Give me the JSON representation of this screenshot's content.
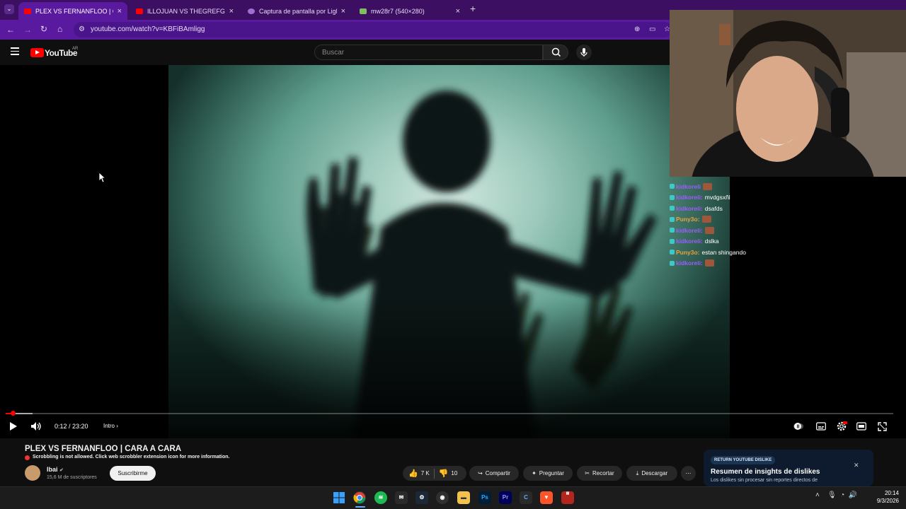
{
  "browser": {
    "tabs": [
      {
        "title": "PLEX VS FERNANFLOO | CARA A",
        "active": true,
        "favicon": "youtube-icon",
        "color": "#ff0000"
      },
      {
        "title": "ILLOJUAN VS THEGREFG | CARA",
        "active": false,
        "favicon": "youtube-icon",
        "color": "#ff0000"
      },
      {
        "title": "Captura de pantalla por Lightsh",
        "active": false,
        "favicon": "lightshot-icon",
        "color": "#a070d0"
      },
      {
        "title": "mw28r7 (540×280)",
        "active": false,
        "favicon": "image-icon",
        "color": "#7fbf5f"
      }
    ],
    "url": "youtube.com/watch?v=KBFiBAmligg",
    "theme_color": "#5a1aa0"
  },
  "youtube": {
    "logo_text": "YouTube",
    "region": "AR",
    "search_placeholder": "Buscar",
    "player": {
      "time": "0:12 / 23:20",
      "chapter": "Intro",
      "progress_fraction": 0.0086,
      "buffered_fraction": 0.03
    },
    "video": {
      "title": "PLEX VS FERNANFLOO | CARA A CARA",
      "scrobble_notice": "Scrobbling is not allowed. Click web scrobbler extension icon for more information.",
      "channel": "Ibai",
      "subscribers": "15,6 M de suscriptores",
      "subscribe_label": "Suscribirme",
      "likes": "7 K",
      "dislikes": "10",
      "share_label": "Compartir",
      "ask_label": "Preguntar",
      "clip_label": "Recortar",
      "download_label": "Descargar"
    },
    "extension": {
      "badge": "RETURN YOUTUBE DISLIKE",
      "title": "Resumen de insights de dislikes",
      "subtitle": "Los dislikes sin procesar sin reportes directos de"
    }
  },
  "chat": [
    {
      "user": "kidkoreli",
      "message": "",
      "emote": true,
      "user_color": "#9b5cff"
    },
    {
      "user": "kidkoreli:",
      "message": "mvdgsxñl",
      "emote": false,
      "user_color": "#9b5cff"
    },
    {
      "user": "kidkoreli:",
      "message": "dsafds",
      "emote": false,
      "user_color": "#9b5cff"
    },
    {
      "user": "Puny3o:",
      "message": "",
      "emote": true,
      "user_color": "#e8a33c"
    },
    {
      "user": "kidkoreli:",
      "message": "",
      "emote": true,
      "user_color": "#9b5cff"
    },
    {
      "user": "kidkoreli:",
      "message": "dslka",
      "emote": false,
      "user_color": "#9b5cff"
    },
    {
      "user": "Puny3o:",
      "message": "estan shingando",
      "emote": false,
      "user_color": "#e8a33c"
    },
    {
      "user": "kidkoreli:",
      "message": "",
      "emote": true,
      "user_color": "#9b5cff"
    }
  ],
  "taskbar": {
    "apps": [
      "windows-start-icon",
      "chrome-icon",
      "spotify-icon",
      "mail-icon",
      "steam-icon",
      "obs-icon",
      "file-explorer-icon",
      "photoshop-icon",
      "premiere-icon",
      "ccleaner-icon",
      "brave-icon",
      "voicemeeter-icon"
    ],
    "time": "20:14",
    "date": "9/3/2026"
  }
}
